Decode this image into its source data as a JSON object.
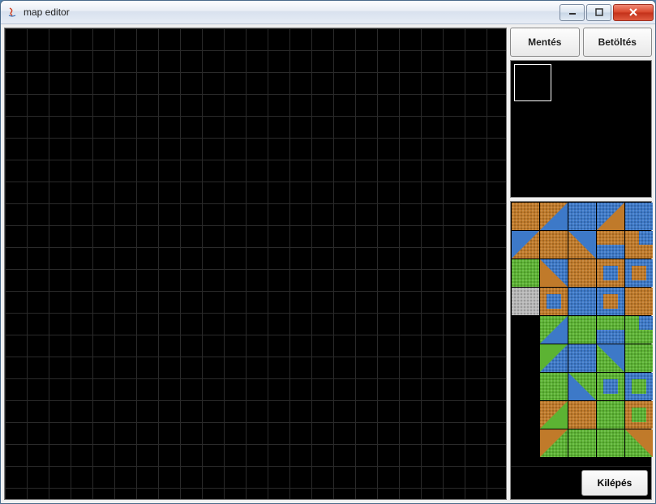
{
  "window": {
    "title": "map editor",
    "icon": "java-icon"
  },
  "buttons": {
    "save": "Mentés",
    "load": "Betöltés",
    "exit": "Kilépés"
  },
  "palette": {
    "colors": {
      "orange": "#c07a2a",
      "blue": "#3d79c8",
      "green": "#5cb333",
      "gray": "#b8b8b8",
      "black": "#000000"
    },
    "tiles": [
      [
        "orange",
        "blue-tri-br",
        "blue",
        "orange-tri-br",
        "blue"
      ],
      [
        "blue-tri-tl",
        "orange",
        "blue-tri-tr",
        "orange-half-t",
        "blue-corner-tr"
      ],
      [
        "green",
        "orange-tri-bl",
        "orange",
        "orange-ring-b",
        "blue-ring-o"
      ],
      [
        "gray",
        "orange-ring-b",
        "blue",
        "blue-ring-o",
        "orange"
      ],
      [
        "black",
        "blue-tri-br-g",
        "green",
        "green-half-t-b",
        "blue-corner-tr-g"
      ],
      [
        "black",
        "green-tri-tl-b",
        "blue",
        "blue-tri-tr-g",
        "green"
      ],
      [
        "black",
        "green",
        "blue-tri-bl-g",
        "green-ring-b",
        "blue-ring-g"
      ],
      [
        "black",
        "green-tri-br-o",
        "orange",
        "green",
        "orange-ring-g"
      ],
      [
        "black",
        "orange-tri-tl-g",
        "green",
        "green-noise",
        "orange-tri-tr-g"
      ]
    ]
  }
}
